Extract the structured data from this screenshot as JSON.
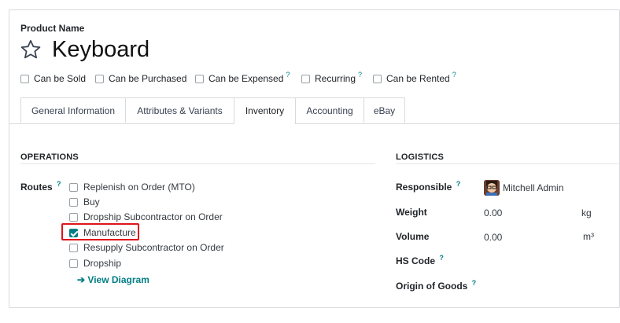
{
  "header": {
    "product_label": "Product Name",
    "product_name": "Keyboard"
  },
  "flags": [
    {
      "label": "Can be Sold",
      "help": ""
    },
    {
      "label": "Can be Purchased",
      "help": ""
    },
    {
      "label": "Can be Expensed",
      "help": "?"
    },
    {
      "label": "Recurring",
      "help": "?"
    },
    {
      "label": "Can be Rented",
      "help": "?"
    }
  ],
  "tabs": [
    {
      "label": "General Information",
      "active": false
    },
    {
      "label": "Attributes & Variants",
      "active": false
    },
    {
      "label": "Inventory",
      "active": true
    },
    {
      "label": "Accounting",
      "active": false
    },
    {
      "label": "eBay",
      "active": false
    }
  ],
  "operations": {
    "title": "OPERATIONS",
    "routes_label": "Routes",
    "routes_help": "?",
    "routes": [
      {
        "label": "Replenish on Order (MTO)",
        "checked": false
      },
      {
        "label": "Buy",
        "checked": false
      },
      {
        "label": "Dropship Subcontractor on Order",
        "checked": false
      },
      {
        "label": "Manufacture",
        "checked": true
      },
      {
        "label": "Resupply Subcontractor on Order",
        "checked": false
      },
      {
        "label": "Dropship",
        "checked": false
      }
    ],
    "diagram_link": "View Diagram",
    "diagram_arrow": "➔"
  },
  "logistics": {
    "title": "LOGISTICS",
    "responsible_label": "Responsible",
    "responsible_help": "?",
    "responsible_value": "Mitchell Admin",
    "weight_label": "Weight",
    "weight_value": "0.00",
    "weight_unit": "kg",
    "volume_label": "Volume",
    "volume_value": "0.00",
    "volume_unit": "m³",
    "hs_code_label": "HS Code",
    "hs_code_help": "?",
    "origin_label": "Origin of Goods",
    "origin_help": "?"
  },
  "colors": {
    "accent": "#017e84",
    "highlight": "#e0141a"
  }
}
